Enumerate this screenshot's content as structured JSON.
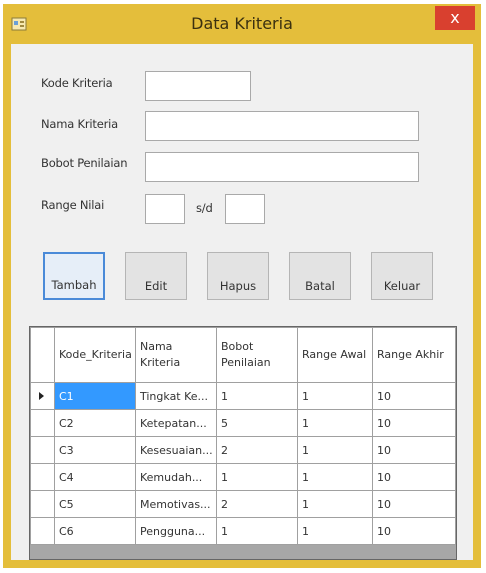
{
  "window": {
    "title": "Data Kriteria",
    "close_glyph": "x",
    "accent": "#e4be3b",
    "close_color": "#d9402f"
  },
  "form": {
    "kode_label": "Kode Kriteria",
    "kode_value": "",
    "nama_label": "Nama Kriteria",
    "nama_value": "",
    "bobot_label": "Bobot Penilaian",
    "bobot_value": "",
    "range_label": "Range Nilai",
    "range_from_value": "",
    "range_sep": "s/d",
    "range_to_value": ""
  },
  "buttons": {
    "tambah": "Tambah",
    "edit": "Edit",
    "hapus": "Hapus",
    "batal": "Batal",
    "keluar": "Keluar"
  },
  "grid": {
    "columns": [
      "Kode_Kriteria",
      "Nama Kriteria",
      "Bobot Penilaian",
      "Range Awal",
      "Range Akhir"
    ],
    "rows": [
      [
        "C1",
        "Tingkat Ke...",
        "1",
        "1",
        "10"
      ],
      [
        "C2",
        "Ketepatan...",
        "5",
        "1",
        "10"
      ],
      [
        "C3",
        "Kesesuaian...",
        "2",
        "1",
        "10"
      ],
      [
        "C4",
        "Kemudah...",
        "1",
        "1",
        "10"
      ],
      [
        "C5",
        "Memotivas...",
        "2",
        "1",
        "10"
      ],
      [
        "C6",
        "Pengguna...",
        "1",
        "1",
        "10"
      ]
    ],
    "selected_row": 0,
    "selection_color": "#3399ff"
  }
}
